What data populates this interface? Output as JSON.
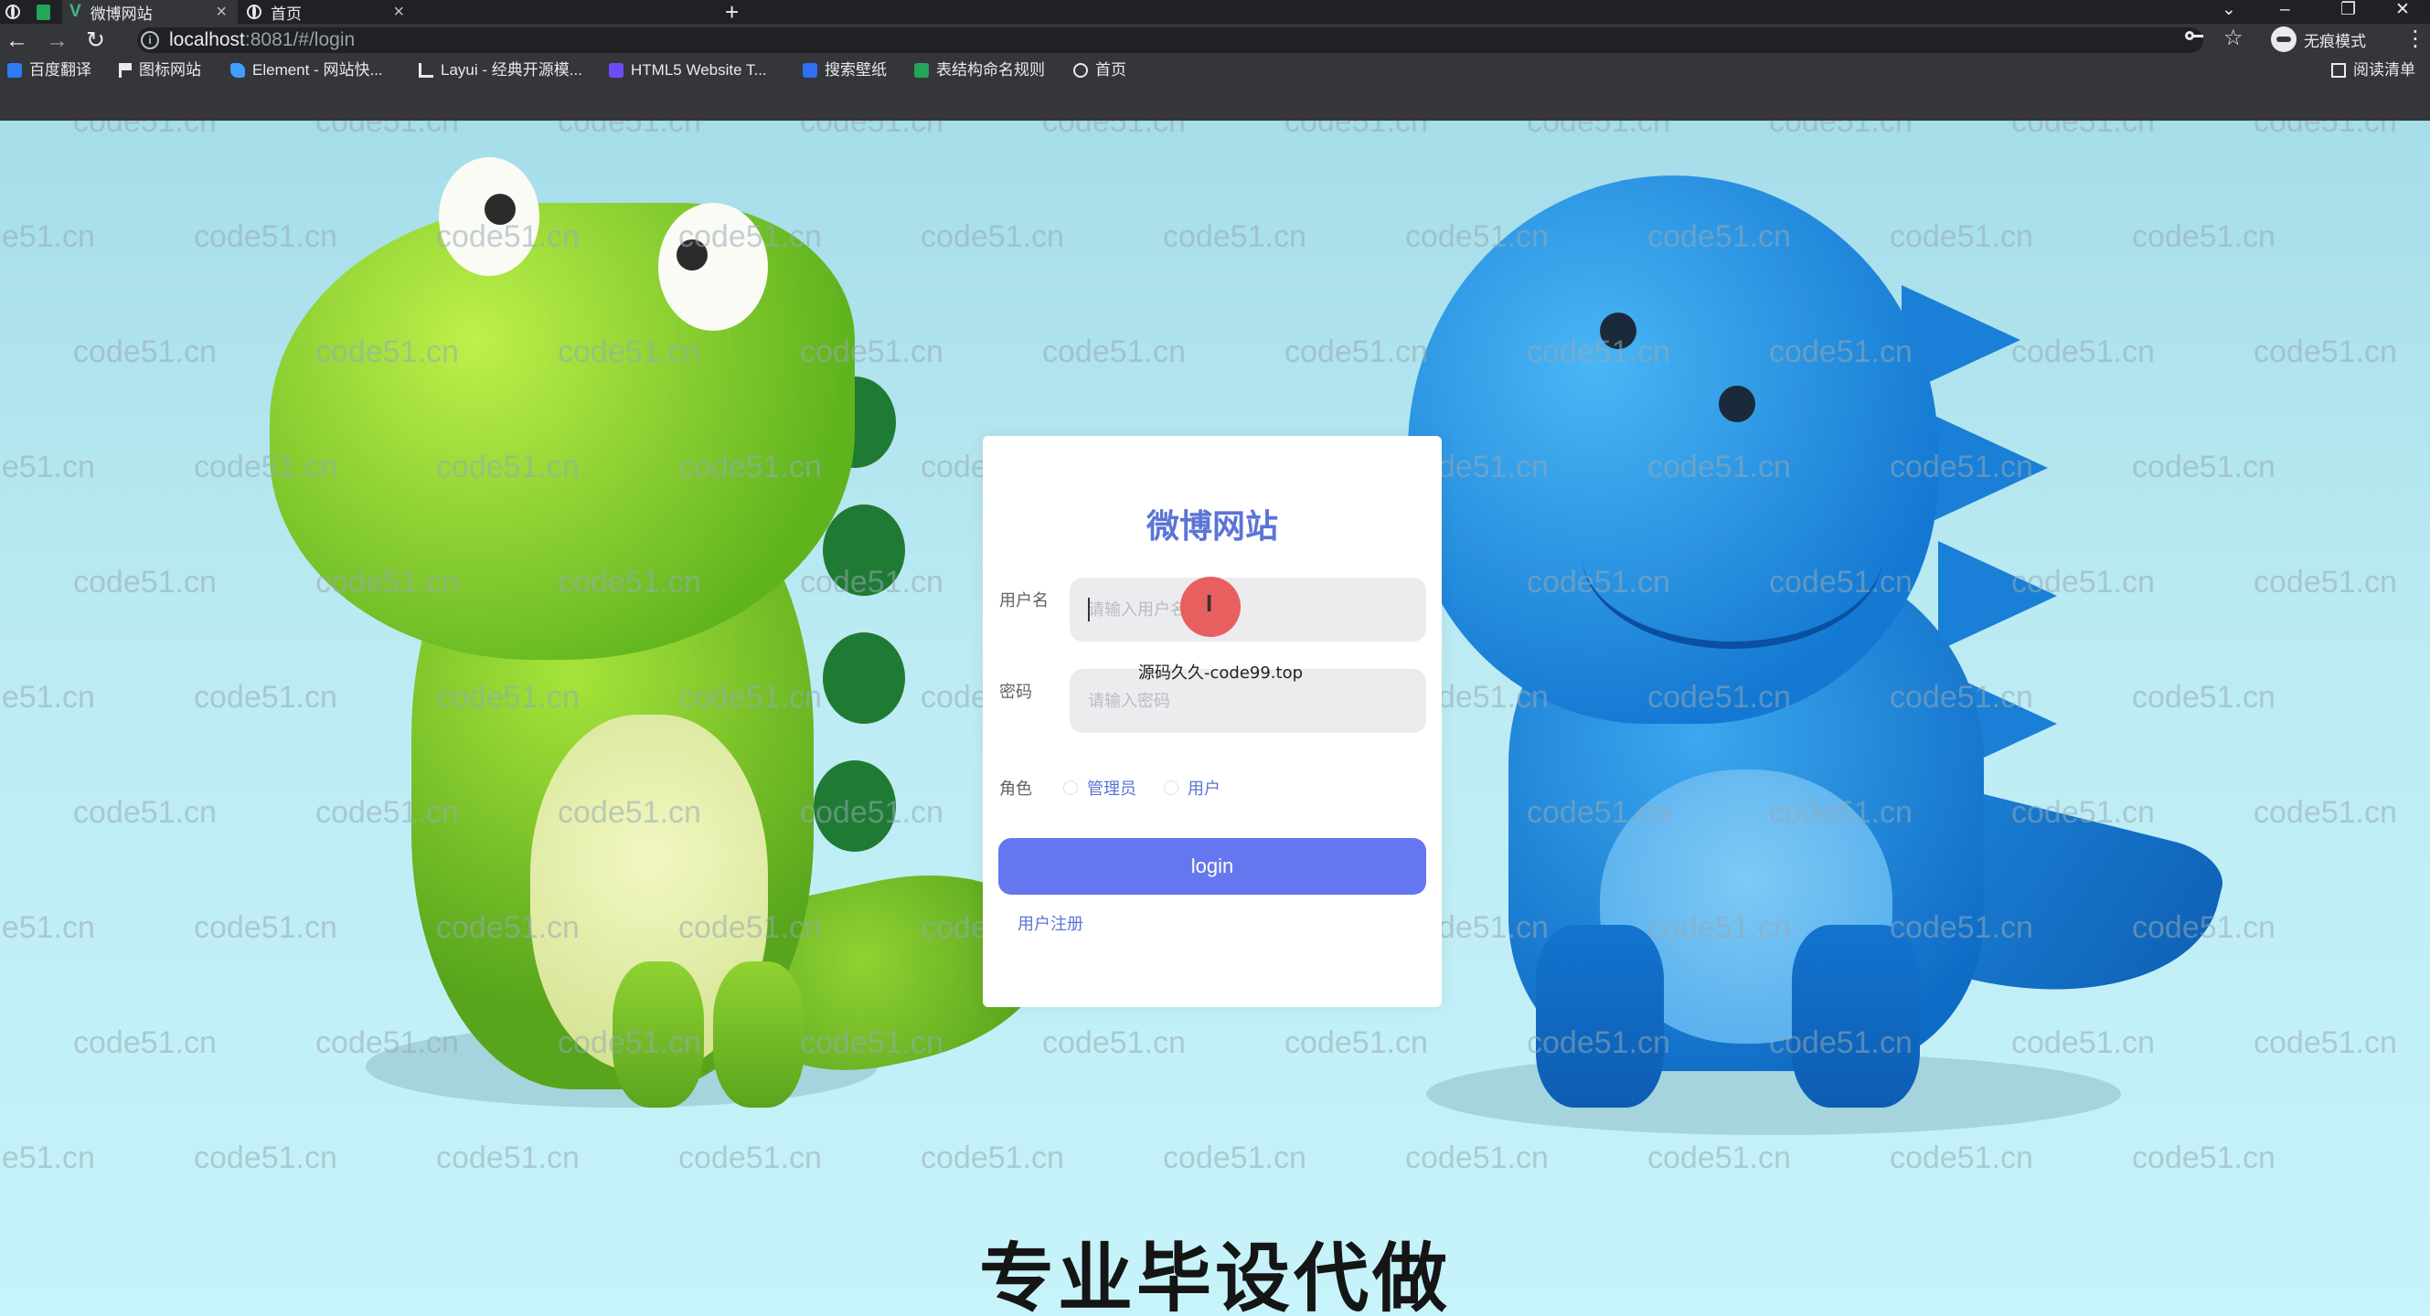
{
  "browser": {
    "tabs": [
      {
        "title": "微博网站",
        "active": true
      },
      {
        "title": "首页",
        "active": false
      }
    ],
    "url": {
      "host": "localhost",
      "rest": ":8081/#/login"
    },
    "incognito_label": "无痕模式",
    "bookmarks": [
      {
        "label": "百度翻译",
        "icon": "baidu-icon"
      },
      {
        "label": "图标网站",
        "icon": "flag-icon"
      },
      {
        "label": "Element - 网站快...",
        "icon": "element-icon"
      },
      {
        "label": "Layui - 经典开源模...",
        "icon": "layui-icon"
      },
      {
        "label": "HTML5 Website T...",
        "icon": "html5-icon"
      },
      {
        "label": "搜索壁纸",
        "icon": "wallpaper-icon"
      },
      {
        "label": "表结构命名规则",
        "icon": "sheet-icon"
      },
      {
        "label": "首页",
        "icon": "globe-icon"
      }
    ],
    "reading_list": "阅读清单"
  },
  "watermark": "code51.cn",
  "login": {
    "title": "微博网站",
    "username_label": "用户名",
    "username_placeholder": "请输入用户名",
    "password_label": "密码",
    "password_placeholder": "请输入密码",
    "role_label": "角色",
    "roles": [
      "管理员",
      "用户"
    ],
    "login_button": "login",
    "register_link": "用户注册"
  },
  "overlay_text": "源码久久-code99.top",
  "banner": "专业毕设代做",
  "colors": {
    "accent": "#6577ef",
    "title": "#5b74d6",
    "chrome": "#35363a"
  }
}
